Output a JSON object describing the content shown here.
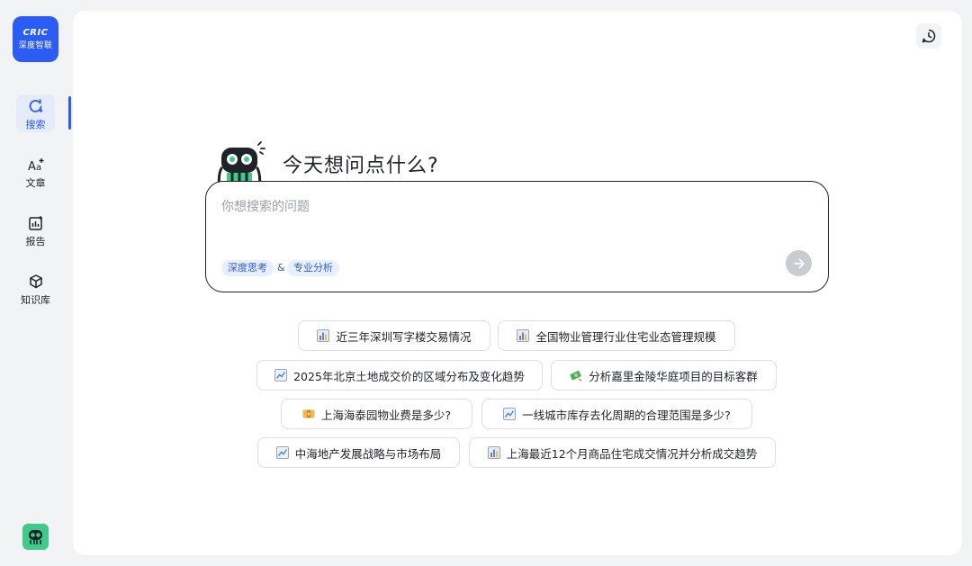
{
  "sidebar": {
    "logo": {
      "line1": "CRIC",
      "line2": "深度智联"
    },
    "items": [
      {
        "label": "搜索",
        "icon": "search-refresh-icon"
      },
      {
        "label": "文章",
        "icon": "text-sparkle-icon"
      },
      {
        "label": "报告",
        "icon": "report-chart-icon"
      },
      {
        "label": "知识库",
        "icon": "knowledge-cube-icon"
      }
    ]
  },
  "main": {
    "greeting": "今天想问点什么?",
    "search": {
      "placeholder": "你想搜索的问题",
      "tags": [
        "深度思考",
        "专业分析"
      ],
      "tag_joiner": "&"
    },
    "suggestions": [
      {
        "text": "近三年深圳写字楼交易情况",
        "icon": "bar-chart-icon"
      },
      {
        "text": "全国物业管理行业住宅业态管理规模",
        "icon": "bar-chart-icon"
      },
      {
        "text": "2025年北京土地成交价的区域分布及变化趋势",
        "icon": "trend-line-icon"
      },
      {
        "text": "分析嘉里金陵华庭项目的目标客群",
        "icon": "money-icon"
      },
      {
        "text": "上海海泰园物业费是多少?",
        "icon": "coin-icon"
      },
      {
        "text": "一线城市库存去化周期的合理范围是多少?",
        "icon": "trend-line-icon"
      },
      {
        "text": "中海地产发展战略与市场布局",
        "icon": "trend-line-icon"
      },
      {
        "text": "上海最近12个月商品住宅成交情况并分析成交趋势",
        "icon": "bar-chart-icon"
      }
    ]
  },
  "colors": {
    "accent": "#2c5cf6",
    "background": "#f2f3f5",
    "panel": "#ffffff"
  }
}
